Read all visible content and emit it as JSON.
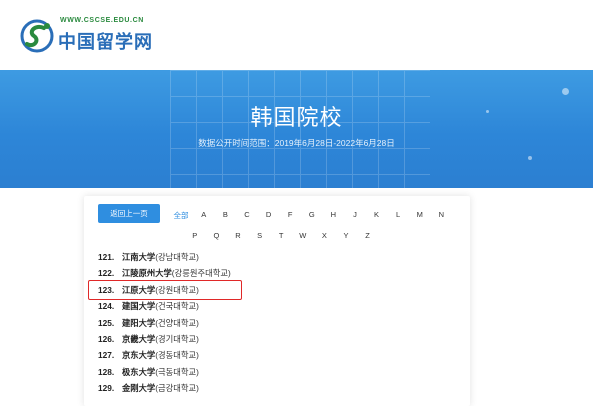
{
  "header": {
    "logo_url": "WWW.CSCSE.EDU.CN",
    "logo_text": "中国留学网"
  },
  "banner": {
    "title": "韩国院校",
    "subtitle": "数据公开时间范围：2019年6月28日-2022年6月28日"
  },
  "nav": {
    "back_label": "返回上一页",
    "all_label": "全部",
    "letters_row1": [
      "A",
      "B",
      "C",
      "D",
      "F",
      "G",
      "H",
      "J",
      "K",
      "L",
      "M",
      "N"
    ],
    "letters_row2": [
      "P",
      "Q",
      "R",
      "S",
      "T",
      "W",
      "X",
      "Y",
      "Z"
    ]
  },
  "universities": [
    {
      "num": "121.",
      "cn": "江南大学",
      "kr": "(강남대학교)"
    },
    {
      "num": "122.",
      "cn": "江陵原州大学",
      "kr": "(강릉원주대학교)"
    },
    {
      "num": "123.",
      "cn": "江原大学",
      "kr": "(강원대학교)"
    },
    {
      "num": "124.",
      "cn": "建国大学",
      "kr": "(건국대학교)"
    },
    {
      "num": "125.",
      "cn": "建阳大学",
      "kr": "(건양대학교)"
    },
    {
      "num": "126.",
      "cn": "京畿大学",
      "kr": "(경기대학교)"
    },
    {
      "num": "127.",
      "cn": "京东大学",
      "kr": "(경동대학교)"
    },
    {
      "num": "128.",
      "cn": "极东大学",
      "kr": "(극동대학교)"
    },
    {
      "num": "129.",
      "cn": "金刚大学",
      "kr": "(금강대학교)"
    }
  ],
  "colors": {
    "brand_blue": "#2f8ee0",
    "banner_blue": "#2d86d8",
    "highlight_red": "#e02828",
    "logo_green": "#2a8a3e"
  }
}
